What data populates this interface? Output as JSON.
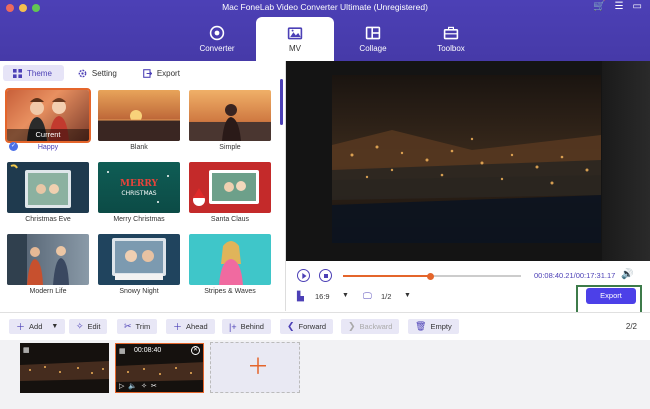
{
  "window": {
    "title": "Mac FoneLab Video Converter Ultimate (Unregistered)",
    "traffic_colors": [
      "#ed6a5e",
      "#f5bf4f",
      "#62c554"
    ]
  },
  "nav": {
    "tabs": [
      {
        "label": "Converter",
        "icon": "converter-icon"
      },
      {
        "label": "MV",
        "icon": "mv-icon"
      },
      {
        "label": "Collage",
        "icon": "collage-icon"
      },
      {
        "label": "Toolbox",
        "icon": "toolbox-icon"
      }
    ],
    "active": "MV"
  },
  "subtabs": [
    {
      "label": "Theme",
      "icon": "grid-icon"
    },
    {
      "label": "Setting",
      "icon": "gear-icon"
    },
    {
      "label": "Export",
      "icon": "export-icon"
    }
  ],
  "themes": [
    {
      "name": "Happy",
      "badge": "Current"
    },
    {
      "name": "Blank"
    },
    {
      "name": "Simple"
    },
    {
      "name": "Christmas Eve"
    },
    {
      "name": "Merry Christmas"
    },
    {
      "name": "Santa Claus"
    },
    {
      "name": "Modern Life"
    },
    {
      "name": "Snowy Night"
    },
    {
      "name": "Stripes & Waves"
    }
  ],
  "player": {
    "time_current": "00:08:40.21",
    "time_total": "00:17:31.17",
    "time_display": "00:08:40.21/00:17:31.17",
    "progress": 0.49,
    "ratio": "16:9",
    "half": "1/2",
    "export_label": "Export"
  },
  "toolbar": {
    "add": "Add",
    "edit": "Edit",
    "trim": "Trim",
    "ahead": "Ahead",
    "behind": "Behind",
    "forward": "Forward",
    "backward": "Backward",
    "empty": "Empty",
    "counter": "2/2"
  },
  "timeline": {
    "clip2_duration": "00:08:40"
  },
  "colors": {
    "brand": "#4c40b6",
    "accent": "#e4652b",
    "export_button": "#4c40e8",
    "highlight": "#3d7b4a"
  }
}
